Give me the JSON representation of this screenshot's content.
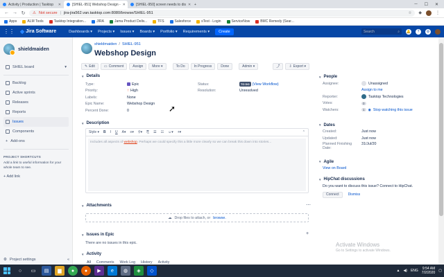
{
  "browser": {
    "tabs": [
      {
        "title": "Activity | Production | Tasktop",
        "active": false
      },
      {
        "title": "[SHIEL-951] Webshop Design - ",
        "active": true
      },
      {
        "title": "[SHIEL-950] screen needs to dis",
        "active": false
      }
    ],
    "new_tab": "+",
    "address": {
      "security": "Not secure",
      "url": "jira-jira562.van.tasktop.com:8080/browse/SHIEL-951"
    },
    "bookmarks": [
      "Apps",
      "ALM Tools",
      "Tasktop Integration...",
      "JIRA",
      "Jama Product Deliv...",
      "TFS",
      "Salesforce",
      "sTest - Login",
      "ServiceNow",
      "BMC Remedy (Sear..."
    ]
  },
  "jira_nav": {
    "product": "Jira Software",
    "menus": [
      "Dashboards ▾",
      "Projects ▾",
      "Issues ▾",
      "Boards ▾",
      "Portfolio ▾",
      "Requirements ▾"
    ],
    "create_label": "Create",
    "search_placeholder": "Search"
  },
  "sidebar": {
    "project_name": "shieldmaiden",
    "items": [
      {
        "label": "SHIEL board",
        "active": false
      },
      {
        "label": "Backlog",
        "active": false
      },
      {
        "label": "Active sprints",
        "active": false
      },
      {
        "label": "Releases",
        "active": false
      },
      {
        "label": "Reports",
        "active": false
      },
      {
        "label": "Issues",
        "active": true
      },
      {
        "label": "Components",
        "active": false
      },
      {
        "label": "Add-ons",
        "active": false
      }
    ],
    "shortcuts_title": "PROJECT SHORTCUTS",
    "shortcuts_desc": "Add a link to useful information for your whole team to see.",
    "add_link": "Add link",
    "settings": "Project settings"
  },
  "issue": {
    "breadcrumb_project": "shieldmaiden",
    "breadcrumb_sep": "/",
    "breadcrumb_key": "SHIEL-951",
    "title": "Webshop Design",
    "toolbar": [
      "Edit",
      "Comment",
      "Assign",
      "More ▾",
      "To Do",
      "In Progress",
      "Done",
      "Admin ▾"
    ],
    "export_label": "Export ▾",
    "details_title": "Details",
    "details_left": [
      {
        "label": "Type:",
        "value": "Epic"
      },
      {
        "label": "Priority:",
        "value": "High"
      },
      {
        "label": "Labels:",
        "value": "None"
      },
      {
        "label": "Epic Name:",
        "value": "Webshop Design"
      },
      {
        "label": "Percent Done:",
        "value": "0"
      }
    ],
    "details_right": [
      {
        "label": "Status:",
        "value": "TO DO",
        "extra": "(View Workflow)"
      },
      {
        "label": "Resolution:",
        "value": "Unresolved"
      }
    ],
    "description_title": "Description",
    "editor_style": "Style ▾",
    "description_text_pre": "Includes all aspects of ",
    "description_highlight": "webshop",
    "description_text_post": ". Perhaps we could specify this a little more clearly so we can break this down into stories...",
    "attachments_title": "Attachments",
    "dropzone_text": "Drop files to attach, or",
    "dropzone_link": "browse.",
    "issues_in_epic_title": "Issues in Epic",
    "issues_in_epic_empty": "There are no issues in this epic.",
    "activity_title": "Activity",
    "activity_tabs": [
      "All",
      "Comments",
      "Work Log",
      "History",
      "Activity"
    ]
  },
  "right": {
    "people_title": "People",
    "assignee_label": "Assignee:",
    "assignee_value": "Unassigned",
    "assign_to_me": "Assign to me",
    "reporter_label": "Reporter:",
    "reporter_value": "Tasktop Technologies",
    "votes_label": "Votes:",
    "votes_value": "0",
    "watchers_label": "Watchers:",
    "watchers_count": "1",
    "watchers_action": "Stop watching this issue",
    "dates_title": "Dates",
    "created_label": "Created:",
    "created_value": "Just now",
    "updated_label": "Updated:",
    "updated_value": "Just now",
    "planned_label": "Planned Finishing Date:",
    "planned_value": "31/Jul/20",
    "agile_title": "Agile",
    "agile_link": "View on Board",
    "hipchat_title": "HipChat discussions",
    "hipchat_question": "Do you want to discuss this issue? Connect to HipChat.",
    "hipchat_connect": "Connect",
    "hipchat_dismiss": "Dismiss"
  },
  "watermark": {
    "title": "Activate Windows",
    "sub": "Go to Settings to activate Windows."
  },
  "taskbar": {
    "lang": "ENG",
    "time": "9:54 AM",
    "date": "7/2/2020"
  },
  "colors": {
    "jira_blue": "#0747a6",
    "link": "#0052cc",
    "priority_high": "#ff5630"
  }
}
